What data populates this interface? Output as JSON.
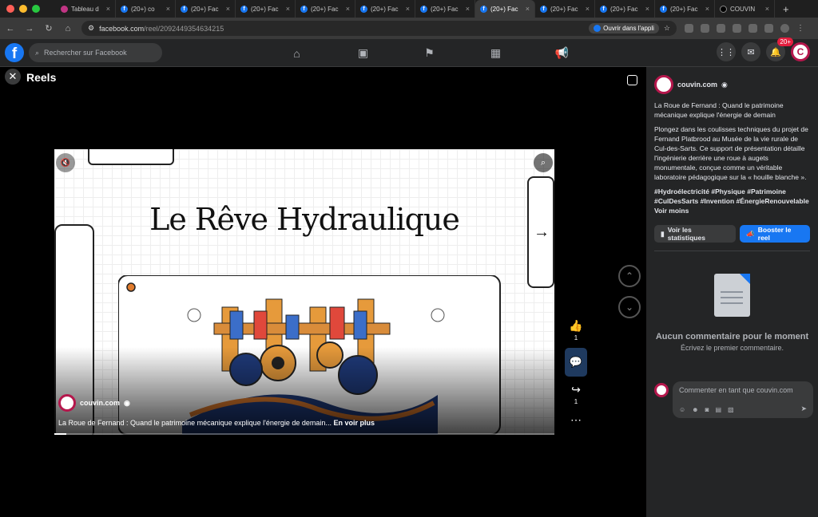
{
  "browser": {
    "tabs": [
      {
        "label": "Tableau d",
        "icon": "pink"
      },
      {
        "label": "(20+) co",
        "icon": "fb"
      },
      {
        "label": "(20+) Fac",
        "icon": "fb"
      },
      {
        "label": "(20+) Fac",
        "icon": "fb"
      },
      {
        "label": "(20+) Fac",
        "icon": "fb"
      },
      {
        "label": "(20+) Fac",
        "icon": "fb"
      },
      {
        "label": "(20+) Fac",
        "icon": "fb"
      },
      {
        "label": "(20+) Fac",
        "icon": "fb",
        "active": true
      },
      {
        "label": "(20+) Fac",
        "icon": "fb"
      },
      {
        "label": "(20+) Fac",
        "icon": "fb"
      },
      {
        "label": "(20+) Fac",
        "icon": "fb"
      },
      {
        "label": "COUVIN",
        "icon": "tt"
      }
    ],
    "url_host": "facebook.com",
    "url_path": "/reel/2092449354634215",
    "open_app": "Ouvrir dans l'appli",
    "colors": {
      "tabstrip": "#1f1f1f",
      "toolbar": "#3a3a3a"
    }
  },
  "fb": {
    "search_placeholder": "Rechercher sur Facebook",
    "notifications_badge": "20+",
    "logo": "f",
    "brand_color": "#1877f2"
  },
  "reels": {
    "title": "Reels",
    "video_title": "Le Rêve Hydraulique",
    "author": "couvin.com",
    "caption": "La Roue de Fernand : Quand le patrimoine mécanique explique l'énergie de demain...",
    "see_more": "En voir plus",
    "likes": "1",
    "shares": "1"
  },
  "panel": {
    "author": "couvin.com",
    "title": "La Roue de Fernand : Quand le patrimoine mécanique explique l'énergie de demain",
    "description": "Plongez dans les coulisses techniques du projet de Fernand Platbrood au Musée de la vie rurale de Cul-des-Sarts. Ce support de présentation détaille l'ingénierie derrière une roue à augets monumentale, conçue comme un véritable laboratoire pédagogique sur la « houille blanche ».",
    "hashtags": "#Hydroélectricité #Physique #Patrimoine #CulDesSarts #Invention #ÉnergieRenouvelable",
    "see_less": "Voir moins",
    "stats_button": "Voir les statistiques",
    "boost_button": "Booster le reel",
    "no_comments": "Aucun commentaire pour le moment",
    "first_comment": "Écrivez le premier commentaire.",
    "comment_placeholder": "Commenter en tant que couvin.com"
  }
}
